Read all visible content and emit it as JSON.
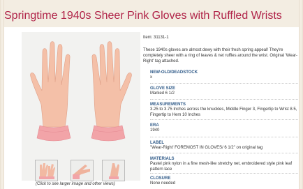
{
  "page": {
    "title": "Springtime 1940s Sheer Pink Gloves with Ruffled Wrists"
  },
  "product": {
    "item_number": "Item: 31131-1",
    "description": "These 1940s gloves are almost dewy with their fresh spring appeal! They're completely sheer with a ring of leaves & net ruffles around the wrist. Original 'Wear-Right' tag attached.",
    "image_caption": "(Click to see larger image and other views)",
    "specs": [
      {
        "label": "NEW-OLD/DEADSTOCK",
        "value": "x"
      },
      {
        "label": "GLOVE SIZE",
        "value": "Marked 6 1/2"
      },
      {
        "label": "MEASUREMENTS",
        "value": "3.25 to 3.75 Inches across the knuckles, Middle Finger 3, Fingertip to Wrist 8.5, Fingertip to Hem 10 Inches"
      },
      {
        "label": "ERA",
        "value": "1940"
      },
      {
        "label": "LABEL",
        "value": "\"Wear-Right' FOREMOST IN GLOVES/ 6 1/2\" on original tag"
      },
      {
        "label": "MATERIALS",
        "value": "Pastel pink nylon in a fine mesh-like stretchy net, embroidered style pink leaf pattern lace"
      },
      {
        "label": "CLOSURE",
        "value": "None needed"
      }
    ]
  },
  "colors": {
    "title": "#b02348",
    "spec_label": "#2f5a88",
    "glove": "#f4c0a8",
    "ruffle": "#f2a4a8"
  }
}
